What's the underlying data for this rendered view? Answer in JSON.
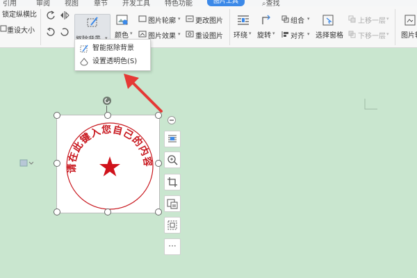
{
  "tabs": [
    {
      "label": "引用"
    },
    {
      "label": "审阅"
    },
    {
      "label": "视图"
    },
    {
      "label": "章节"
    },
    {
      "label": "开发工具"
    },
    {
      "label": "特色功能"
    },
    {
      "label": "图片工具"
    }
  ],
  "search_label": "查找",
  "ribbon": {
    "lock_ratio": "锁定纵横比",
    "reset_size": "重设大小",
    "remove_bg": "抠除背景",
    "color": "颜色",
    "picture_outline": "图片轮廓",
    "picture_effect": "图片效果",
    "change_picture": "更改图片",
    "reset_picture": "重设图片",
    "wrap": "环绕",
    "rotate": "旋转",
    "group": "组合",
    "align": "对齐",
    "selection_pane": "选择窗格",
    "bring_forward": "上移一层",
    "send_backward": "下移一层",
    "picture_partial": "图片转"
  },
  "dropdown": {
    "items": [
      {
        "label": "智能抠除背景"
      },
      {
        "label": "设置透明色(S)"
      }
    ]
  },
  "stamp": {
    "text": "请在此键入您自己的内容",
    "color": "#c8161d"
  },
  "side_toolbar": {
    "more_label": "···"
  },
  "colors": {
    "accent": "#3c89e8",
    "canvas": "#c9e6cf",
    "arrow": "#e53935"
  }
}
